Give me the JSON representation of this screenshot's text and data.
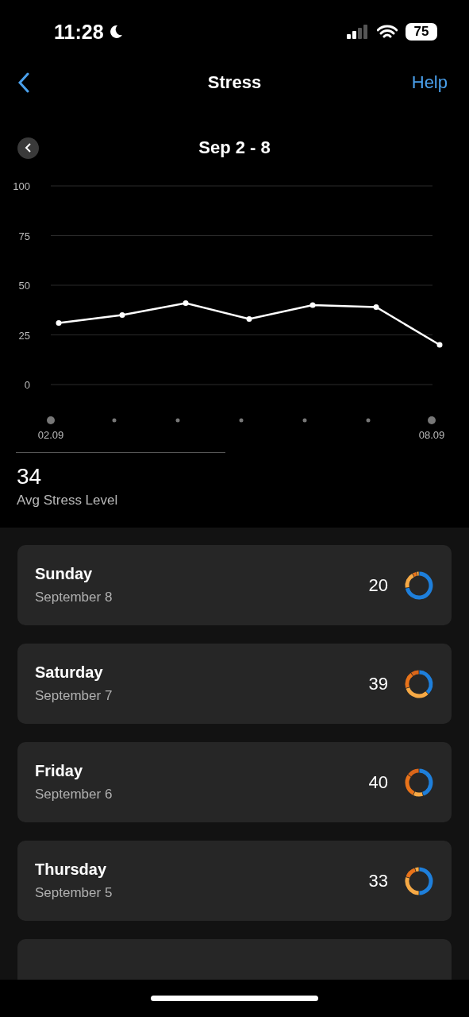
{
  "status_bar": {
    "time": "11:28",
    "battery": "75"
  },
  "nav": {
    "title": "Stress",
    "help": "Help"
  },
  "week": {
    "label": "Sep 2 - 8"
  },
  "chart": {
    "chart_data": {
      "type": "line",
      "categories": [
        "02.09",
        null,
        null,
        null,
        null,
        null,
        "08.09"
      ],
      "yticks": [
        100,
        75,
        50,
        25,
        0
      ],
      "ylim": [
        0,
        100
      ],
      "grid": true,
      "series": [
        {
          "color": "#ffffff",
          "marker": "circle",
          "values": [
            31,
            35,
            41,
            33,
            40,
            39,
            20
          ]
        }
      ]
    }
  },
  "summary": {
    "value": "34",
    "label": "Avg Stress Level"
  },
  "days": [
    {
      "day": "Sunday",
      "date": "September 8",
      "value": "20",
      "segments": [
        {
          "color": "#1e7fdb"
        },
        {
          "color": "#f6a945"
        },
        {
          "color": "#e8731a"
        },
        {
          "color": "#f6a945"
        }
      ]
    },
    {
      "day": "Saturday",
      "date": "September 7",
      "value": "39",
      "segments": [
        {
          "color": "#1e7fdb"
        },
        {
          "color": "#f6a945"
        },
        {
          "color": "#e8731a"
        },
        {
          "color": "#d9661a"
        }
      ]
    },
    {
      "day": "Friday",
      "date": "September 6",
      "value": "40",
      "segments": [
        {
          "color": "#1e7fdb"
        },
        {
          "color": "#f6a945"
        },
        {
          "color": "#e8731a"
        },
        {
          "color": "#d9661a"
        }
      ]
    },
    {
      "day": "Thursday",
      "date": "September 5",
      "value": "33",
      "segments": [
        {
          "color": "#1e7fdb"
        },
        {
          "color": "#f6a945"
        },
        {
          "color": "#e8731a"
        },
        {
          "color": "#f6a945"
        }
      ]
    }
  ]
}
